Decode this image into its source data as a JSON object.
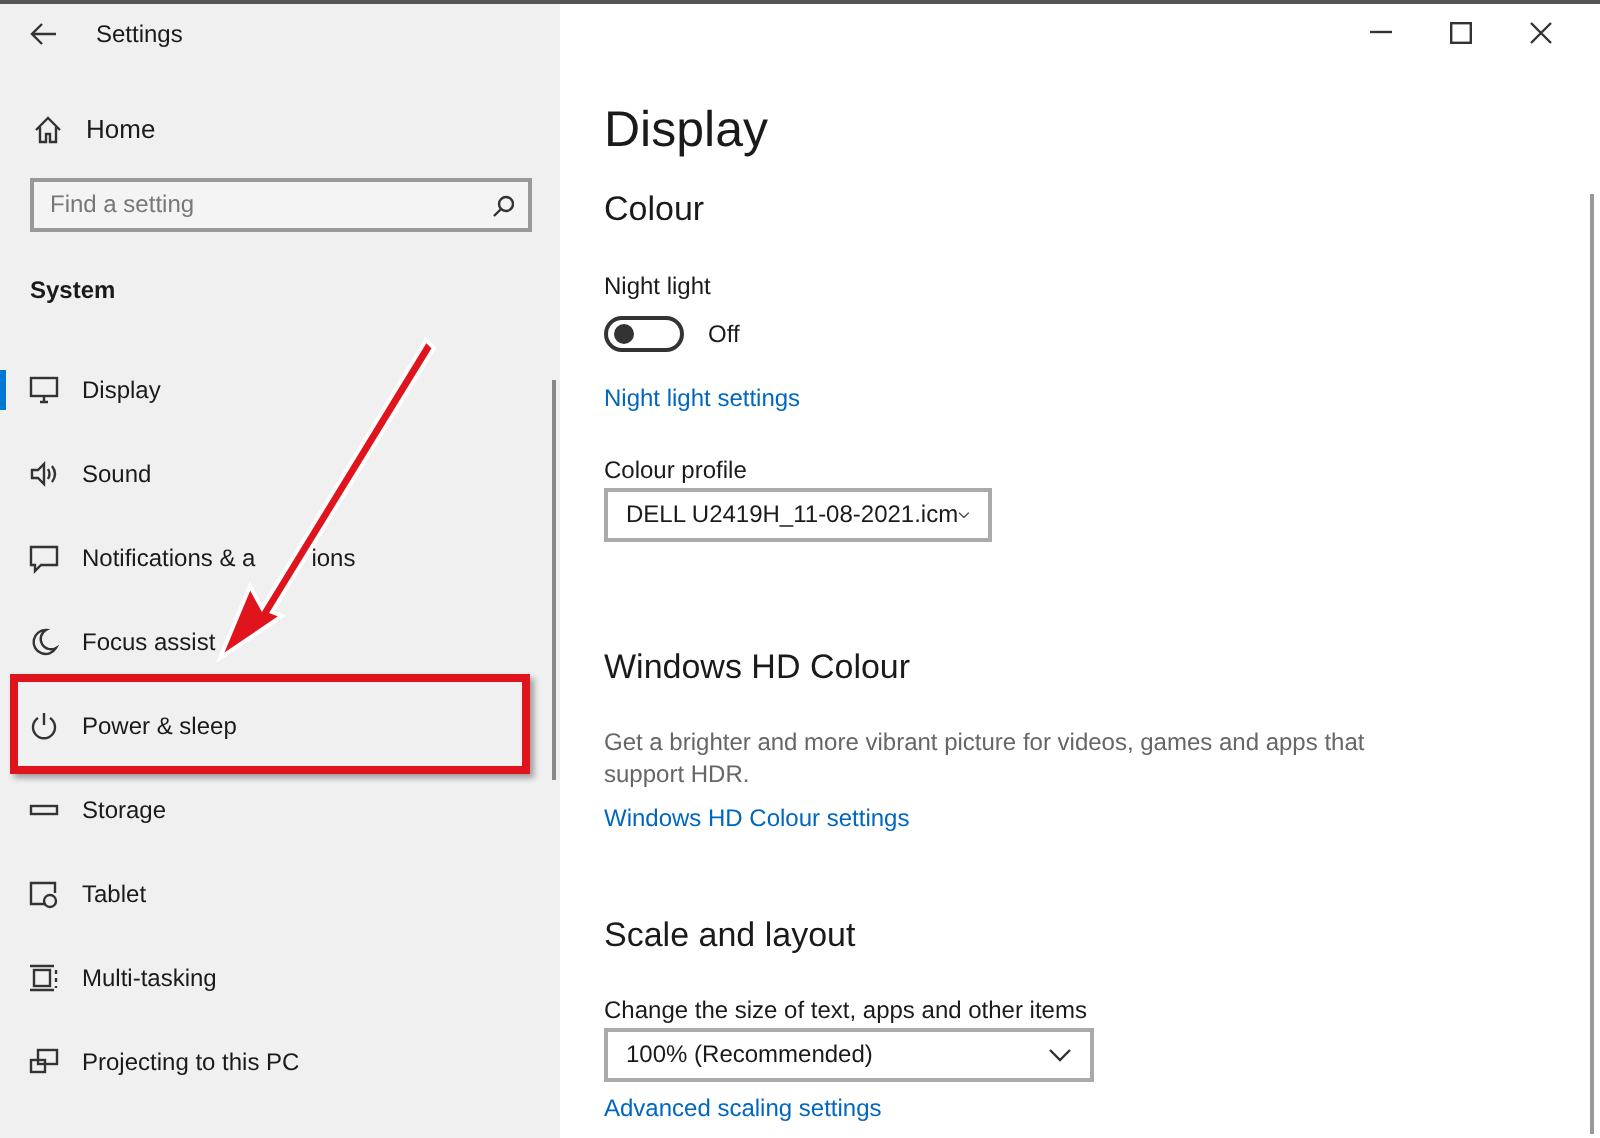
{
  "window": {
    "title": "Settings"
  },
  "sidebar": {
    "home": "Home",
    "search": {
      "placeholder": "Find a setting"
    },
    "section": "System",
    "items": [
      {
        "label": "Display",
        "selected": true
      },
      {
        "label": "Sound",
        "selected": false
      },
      {
        "label": "Notifications & a",
        "label_tail": "ions",
        "selected": false
      },
      {
        "label": "Focus assist",
        "selected": false
      },
      {
        "label": "Power & sleep",
        "selected": false,
        "highlighted": true
      },
      {
        "label": "Storage",
        "selected": false
      },
      {
        "label": "Tablet",
        "selected": false
      },
      {
        "label": "Multi-tasking",
        "selected": false
      },
      {
        "label": "Projecting to this PC",
        "selected": false
      }
    ]
  },
  "page": {
    "title": "Display",
    "colour": {
      "heading": "Colour",
      "night_light": {
        "label": "Night light",
        "on": false,
        "state": "Off"
      },
      "link": "Night light settings",
      "profile_label": "Colour profile",
      "profile": "DELL U2419H_11-08-2021.icm"
    },
    "hd": {
      "heading": "Windows HD Colour",
      "description": "Get a brighter and more vibrant picture for videos, games and apps that support HDR.",
      "link": "Windows HD Colour settings"
    },
    "scale": {
      "heading": "Scale and layout",
      "label": "Change the size of text, apps and other items",
      "value": "100% (Recommended)",
      "link": "Advanced scaling settings"
    }
  }
}
